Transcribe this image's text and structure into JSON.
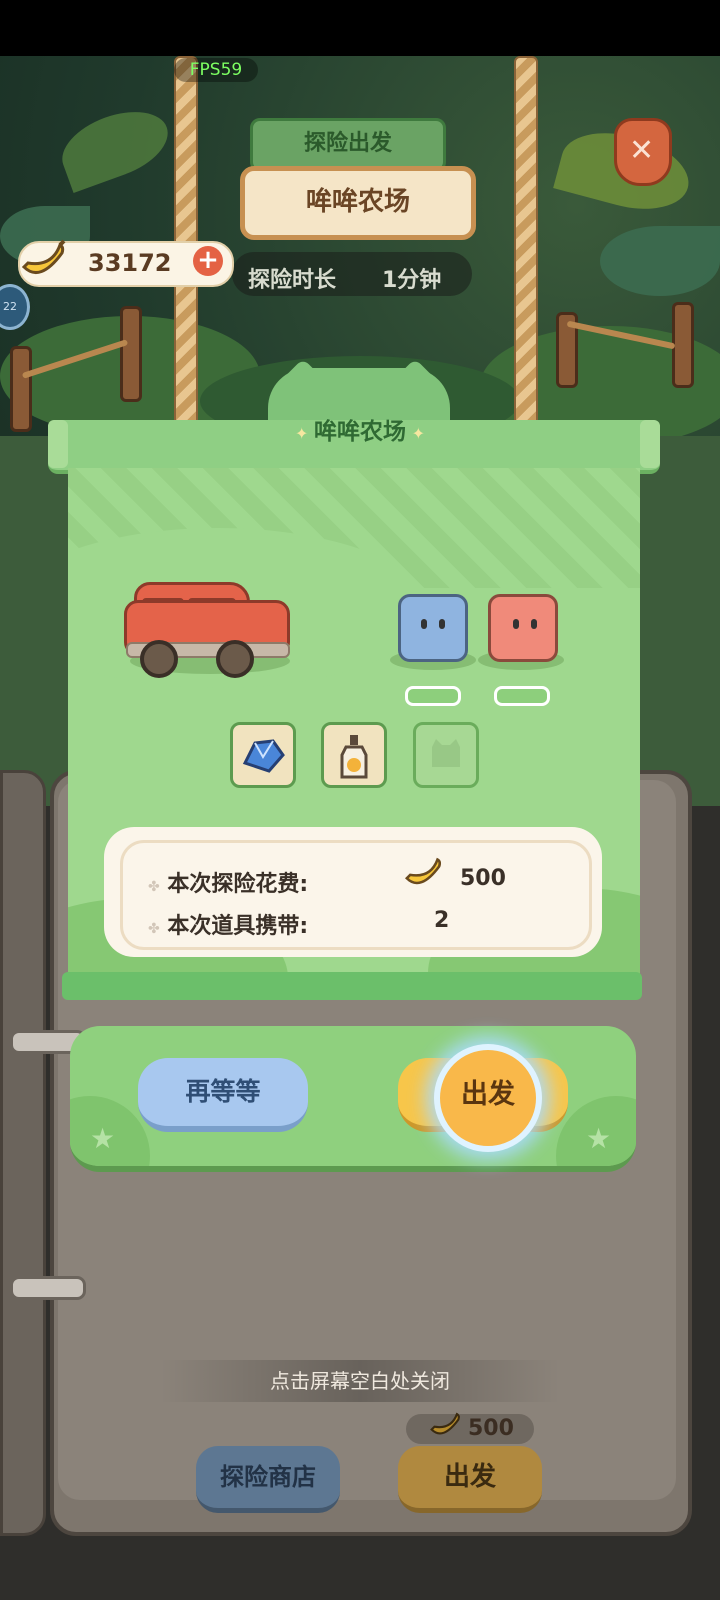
{
  "fps": "FPS59",
  "header": {
    "title": "探险出发",
    "location": "哞哞农场",
    "duration_label": "探险时长",
    "duration_value": "1分钟"
  },
  "currency": {
    "bananas": "33172",
    "add_symbol": "+"
  },
  "side_badge": "22",
  "panel": {
    "title": "哞哞农场",
    "slots": [
      "",
      ""
    ],
    "items": [
      {
        "icon": "blue-crystal-icon",
        "filled": true
      },
      {
        "icon": "bottle-icon",
        "filled": true
      },
      {
        "icon": "cat-silhouette-icon",
        "filled": false
      }
    ],
    "cost_label": "本次探险花费:",
    "cost_value": "500",
    "items_label": "本次道具携带:",
    "items_value": "2"
  },
  "actions": {
    "wait": "再等等",
    "go": "出发"
  },
  "footer": {
    "close_hint": "点击屏幕空白处关闭",
    "cost": "500",
    "shop": "探险商店",
    "go": "出发"
  },
  "colors": {
    "panel_green": "#9fd88e",
    "go_yellow": "#f7c64a",
    "wait_blue": "#a8c8ef",
    "car_red": "#e4634a"
  }
}
